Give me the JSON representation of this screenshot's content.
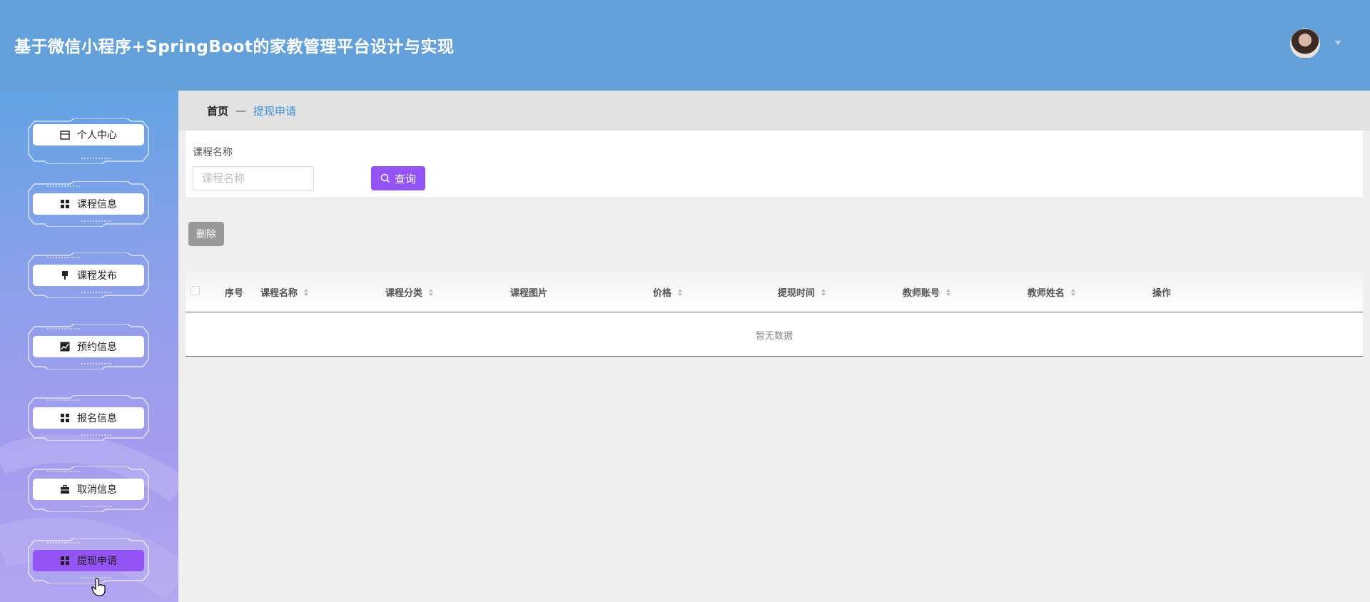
{
  "header": {
    "title": "基于微信小程序+SpringBoot的家教管理平台设计与实现"
  },
  "sidebar": {
    "items": [
      {
        "label": "个人中心",
        "icon": "calendar-icon",
        "active": false
      },
      {
        "label": "课程信息",
        "icon": "grid-icon",
        "active": false
      },
      {
        "label": "课程发布",
        "icon": "pin-icon",
        "active": false
      },
      {
        "label": "预约信息",
        "icon": "chart-icon",
        "active": false
      },
      {
        "label": "报名信息",
        "icon": "grid-icon",
        "active": false
      },
      {
        "label": "取消信息",
        "icon": "briefcase-icon",
        "active": false
      },
      {
        "label": "提现申请",
        "icon": "grid-icon",
        "active": true
      }
    ]
  },
  "breadcrumb": {
    "home": "首页",
    "separator": "—",
    "current": "提现申请"
  },
  "search": {
    "label": "课程名称",
    "placeholder": "课程名称",
    "value": "",
    "button": "查询"
  },
  "toolbar": {
    "delete": "删除"
  },
  "table": {
    "columns": [
      "序号",
      "课程名称",
      "课程分类",
      "课程图片",
      "价格",
      "提现时间",
      "教师账号",
      "教师姓名",
      "操作"
    ],
    "empty_text": "暂无数据",
    "rows": []
  },
  "colors": {
    "header_bg": "#64a1db",
    "accent_purple": "#9353f5",
    "breadcrumb_link": "#3d8fd6",
    "delete_gray": "#999999"
  }
}
